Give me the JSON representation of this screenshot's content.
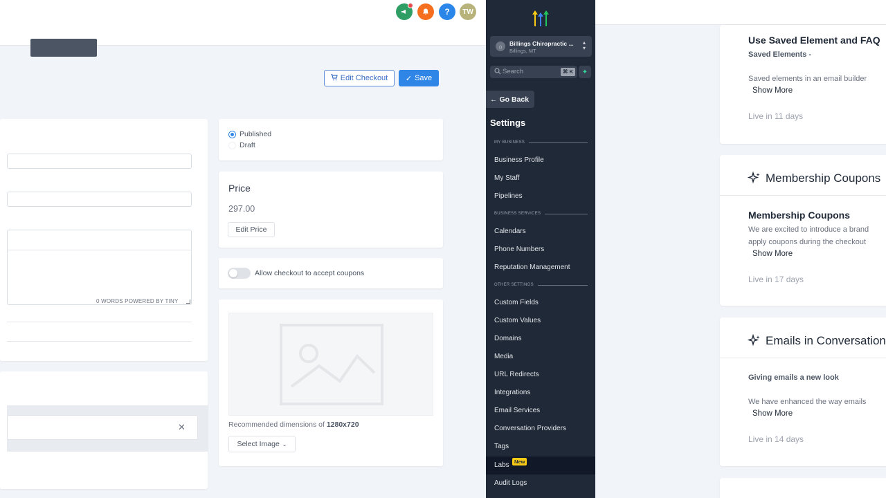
{
  "header": {
    "avatar_initials": "TW",
    "icons": [
      "megaphone-icon",
      "bell-icon",
      "help-icon"
    ],
    "colors": {
      "announce": "#2f9e64",
      "bell": "#f56f1f",
      "help": "#2a86e8",
      "avatar": "#b7b37a"
    }
  },
  "toolbar": {
    "edit_checkout_label": "Edit Checkout",
    "save_label": "Save"
  },
  "status": {
    "published_label": "Published",
    "draft_label": "Draft",
    "selected": "Published"
  },
  "price": {
    "title": "Price",
    "value": "297.00",
    "edit_label": "Edit Price"
  },
  "coupons": {
    "label": "Allow checkout to accept coupons",
    "enabled": false
  },
  "editor": {
    "footer": "0 WORDS  POWERED BY TINY"
  },
  "image": {
    "rec_prefix": "Recommended dimensions of ",
    "rec_dims": "1280x720",
    "select_label": "Select Image"
  },
  "sidebar": {
    "location_name": "Billings Chiropractic ...",
    "location_sub": "Billings, MT",
    "search_placeholder": "Search",
    "search_shortcut": "⌘ K",
    "go_back": "Go Back",
    "title": "Settings",
    "sections": {
      "my_business": "MY BUSINESS",
      "business_services": "BUSINESS SERVICES",
      "other_settings": "OTHER SETTINGS"
    },
    "items": [
      "Business Profile",
      "My Staff",
      "Pipelines",
      "Calendars",
      "Phone Numbers",
      "Reputation Management",
      "Custom Fields",
      "Custom Values",
      "Domains",
      "Media",
      "URL Redirects",
      "Integrations",
      "Email Services",
      "Conversation Providers",
      "Tags",
      "Labs",
      "Audit Logs"
    ],
    "labs_badge": "New",
    "active_item": "Labs"
  },
  "labs": {
    "card1": {
      "title": "Use Saved Element and FAQ",
      "subtitle": "Saved Elements -",
      "body": "Saved elements in an email builder",
      "more": "Show More",
      "live": "Live in 11 days"
    },
    "card2": {
      "header": "Membership Coupons",
      "title": "Membership Coupons",
      "body1": "We are excited to introduce a brand",
      "body2": "apply coupons during the checkout",
      "more": "Show More",
      "live": "Live in 17 days"
    },
    "card3": {
      "header": "Emails in Conversations",
      "subtitle": "Giving emails a new look",
      "body": "We have enhanced the way emails",
      "more": "Show More",
      "live": "Live in 14 days"
    }
  }
}
